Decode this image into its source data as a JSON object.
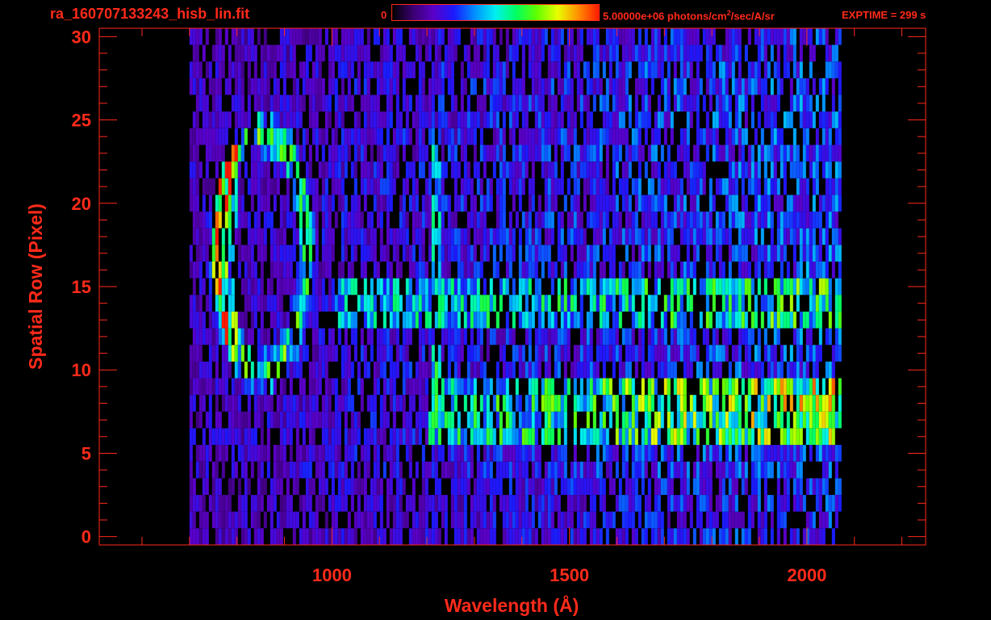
{
  "header": {
    "filename": "ra_160707133243_hisb_lin.fit",
    "colorbar_min": "0",
    "colorbar_max_prefix": "5.00000e+06 photons/cm",
    "colorbar_max_sup": "2",
    "colorbar_max_suffix": "/sec/A/sr",
    "exptime": "EXPTIME = 299 s"
  },
  "colors": {
    "axis": "#ff2a1a",
    "background": "#000000",
    "colormap": [
      "#000000",
      "#3a0070",
      "#5a00c8",
      "#1a1aff",
      "#0090ff",
      "#00f0f0",
      "#00ff60",
      "#60ff00",
      "#e8ff00",
      "#ff9000",
      "#ff1a00"
    ]
  },
  "chart_data": {
    "type": "heatmap",
    "xlabel": "Wavelength (Å)",
    "ylabel": "Spatial Row (Pixel)",
    "xlim": [
      510,
      2250
    ],
    "ylim": [
      -0.5,
      30.5
    ],
    "x_ticks": [
      1000,
      1500,
      2000
    ],
    "y_ticks": [
      0,
      5,
      10,
      15,
      20,
      25,
      30
    ],
    "color_range": [
      0,
      5000000
    ],
    "colorscale": "rainbow",
    "data_extent": {
      "x": [
        700,
        2070
      ],
      "y": [
        0,
        30
      ]
    },
    "features": [
      {
        "name": "",
        "center_x": 850,
        "center_y": 17,
        "x_radius": 100,
        "y_radius": 7.5,
        "value": 0.6
      },
      {
        "name": "",
        "x": 1216,
        "y_range": [
          6,
          24
        ],
        "value": 0.55
      },
      {
        "name": "",
        "y_range": [
          6,
          9
        ],
        "x_range": [
          1200,
          2070
        ],
        "value_start": 0.5,
        "value_end": 0.75
      },
      {
        "name": "",
        "y_range": [
          13,
          15
        ],
        "x_range": [
          1000,
          2070
        ],
        "value_start": 0.45,
        "value_end": 0.6
      }
    ]
  }
}
